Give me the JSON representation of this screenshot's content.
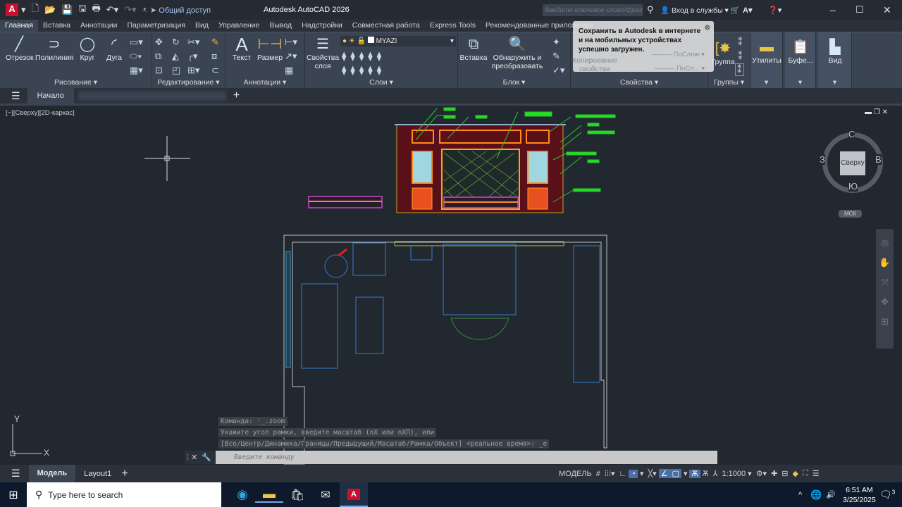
{
  "app": {
    "title": "Autodesk AutoCAD 2026",
    "logo": "A",
    "share": "Общий доступ",
    "search_placeholder": "Введите ключевое слово/фразу",
    "signin": "Вход в службы"
  },
  "ribbon_tabs": [
    "Главная",
    "Вставка",
    "Аннотации",
    "Параметризация",
    "Вид",
    "Управление",
    "Вывод",
    "Надстройки",
    "Совместная работа",
    "Express Tools",
    "Рекомендованные приложения"
  ],
  "panels": {
    "draw": {
      "title": "Рисование",
      "tools": [
        "Отрезок",
        "Полилиния",
        "Круг",
        "Дуга"
      ]
    },
    "modify": {
      "title": "Редактирование"
    },
    "annot": {
      "title": "Аннотации",
      "tools": [
        "Текст",
        "Размер"
      ]
    },
    "layers": {
      "title": "Слои",
      "props": "Свойства слоя",
      "current_layer": "MYAZI"
    },
    "block": {
      "title": "Блок",
      "tools": [
        "Вставка",
        "Обнаружить и преобразовать"
      ]
    },
    "props": {
      "title": "Свойства",
      "copy": "Копирование свойства",
      "line1": "ПоСлою",
      "line2": "ПоСл..."
    },
    "groups": {
      "title": "Группы",
      "tool": "Группа"
    },
    "utils": {
      "tool": "Утилиты"
    },
    "clip": {
      "tool": "Буфе..."
    },
    "view": {
      "tool": "Вид"
    }
  },
  "tooltip": {
    "text": "Сохранить в Autodesk в интернете и на мобильных устройствах успешно загружен."
  },
  "file_tabs": {
    "start": "Начало"
  },
  "viewport": {
    "label": "[−][Сверху][2D-каркас]",
    "viewcube": {
      "top": "Сверху",
      "n": "С",
      "s": "Ю",
      "e": "В",
      "w": "З",
      "ucs": "МСК"
    },
    "axis_x": "X",
    "axis_y": "Y"
  },
  "command": {
    "history": [
      "Команда: '_.zoom",
      "Укажите угол рамки, введите масштаб (nX или nXП), или",
      "[Все/Центр/Динамика/Границы/Предыдущий/Масштаб/Рамка/Объект] <реальное время>: _e"
    ],
    "placeholder": "Введите команду"
  },
  "layout_tabs": [
    "Модель",
    "Layout1"
  ],
  "status": {
    "mode": "МОДЕЛЬ",
    "scale": "1:1000"
  },
  "taskbar": {
    "search": "Type here to search",
    "time": "6:51 AM",
    "date": "3/25/2025",
    "notifications": "3"
  }
}
